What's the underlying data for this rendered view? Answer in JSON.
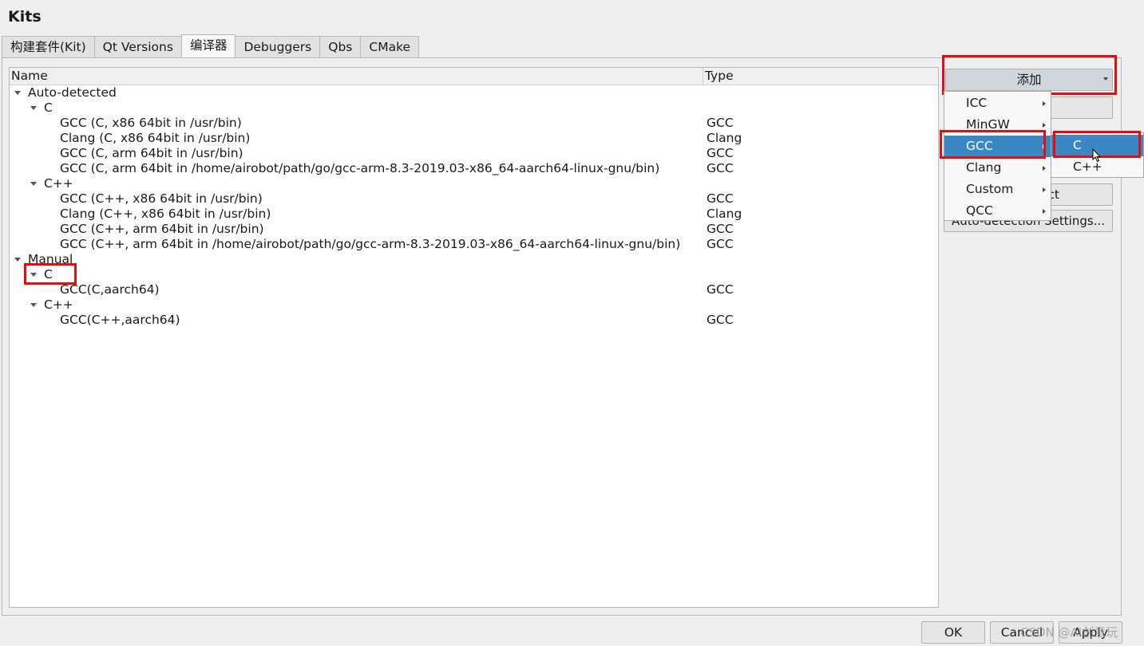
{
  "window": {
    "title": "Kits"
  },
  "tabs": [
    {
      "label": "构建套件(Kit)",
      "active": false
    },
    {
      "label": "Qt Versions",
      "active": false
    },
    {
      "label": "编译器",
      "active": true
    },
    {
      "label": "Debuggers",
      "active": false
    },
    {
      "label": "Qbs",
      "active": false
    },
    {
      "label": "CMake",
      "active": false
    }
  ],
  "tree": {
    "columns": {
      "name": "Name",
      "type": "Type"
    },
    "groups": {
      "auto": "Auto-detected",
      "auto_c": "C",
      "auto_c_items": [
        {
          "name": "GCC (C, x86 64bit in /usr/bin)",
          "type": "GCC"
        },
        {
          "name": "Clang (C, x86 64bit in /usr/bin)",
          "type": "Clang"
        },
        {
          "name": "GCC (C, arm 64bit in /usr/bin)",
          "type": "GCC"
        },
        {
          "name": "GCC (C, arm 64bit in /home/airobot/path/go/gcc-arm-8.3-2019.03-x86_64-aarch64-linux-gnu/bin)",
          "type": "GCC"
        }
      ],
      "auto_cpp": "C++",
      "auto_cpp_items": [
        {
          "name": "GCC (C++, x86 64bit in /usr/bin)",
          "type": "GCC"
        },
        {
          "name": "Clang (C++, x86 64bit in /usr/bin)",
          "type": "Clang"
        },
        {
          "name": "GCC (C++, arm 64bit in /usr/bin)",
          "type": "GCC"
        },
        {
          "name": "GCC (C++, arm 64bit in /home/airobot/path/go/gcc-arm-8.3-2019.03-x86_64-aarch64-linux-gnu/bin)",
          "type": "GCC"
        }
      ],
      "manual": "Manual",
      "manual_c": "C",
      "manual_c_items": [
        {
          "name": "GCC(C,aarch64)",
          "type": "GCC"
        }
      ],
      "manual_cpp": "C++",
      "manual_cpp_items": [
        {
          "name": "GCC(C++,aarch64)",
          "type": "GCC"
        }
      ]
    }
  },
  "side": {
    "add_label": "添加",
    "partial_button_text": "ct",
    "auto_detection_settings": "Auto-detection Settings..."
  },
  "add_menu": {
    "items": [
      {
        "label": "ICC",
        "selected": false
      },
      {
        "label": "MinGW",
        "selected": false
      },
      {
        "label": "GCC",
        "selected": true
      },
      {
        "label": "Clang",
        "selected": false
      },
      {
        "label": "Custom",
        "selected": false
      },
      {
        "label": "QCC",
        "selected": false
      }
    ]
  },
  "gcc_submenu": {
    "items": [
      {
        "label": "C",
        "selected": true
      },
      {
        "label": "C++",
        "selected": false
      }
    ]
  },
  "dialog_buttons": {
    "ok": "OK",
    "cancel": "Cancel",
    "apply": "Apply"
  },
  "watermark": "CSDN @AI创意玩",
  "colors": {
    "selection": "#3a87c3",
    "highlight_box": "#e01010"
  }
}
